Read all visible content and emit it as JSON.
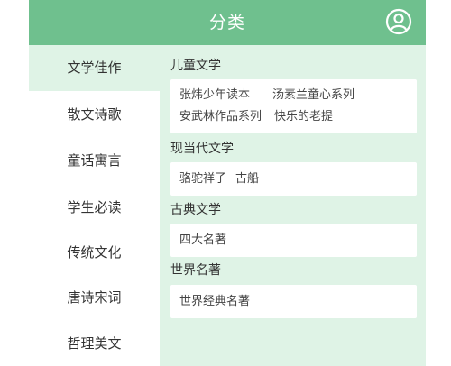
{
  "header": {
    "title": "分类",
    "user_icon": "user-circle-icon"
  },
  "sidebar": {
    "items": [
      {
        "label": "文学佳作",
        "active": true
      },
      {
        "label": "散文诗歌",
        "active": false
      },
      {
        "label": "童话寓言",
        "active": false
      },
      {
        "label": "学生必读",
        "active": false
      },
      {
        "label": "传统文化",
        "active": false
      },
      {
        "label": "唐诗宋词",
        "active": false
      },
      {
        "label": "哲理美文",
        "active": false
      }
    ]
  },
  "content": {
    "sections": [
      {
        "title": "儿童文学",
        "links": [
          "张炜少年读本",
          "汤素兰童心系列",
          "安武林作品系列",
          "快乐的老提"
        ]
      },
      {
        "title": "现当代文学",
        "links": [
          "骆驼祥子",
          "古船"
        ]
      },
      {
        "title": "古典文学",
        "links": [
          "四大名著"
        ]
      },
      {
        "title": "世界名著",
        "links": [
          "世界经典名著"
        ]
      }
    ]
  },
  "colors": {
    "header_bg": "#6fc08e",
    "content_bg": "#dff3e6",
    "sidebar_bg": "#ffffff"
  }
}
